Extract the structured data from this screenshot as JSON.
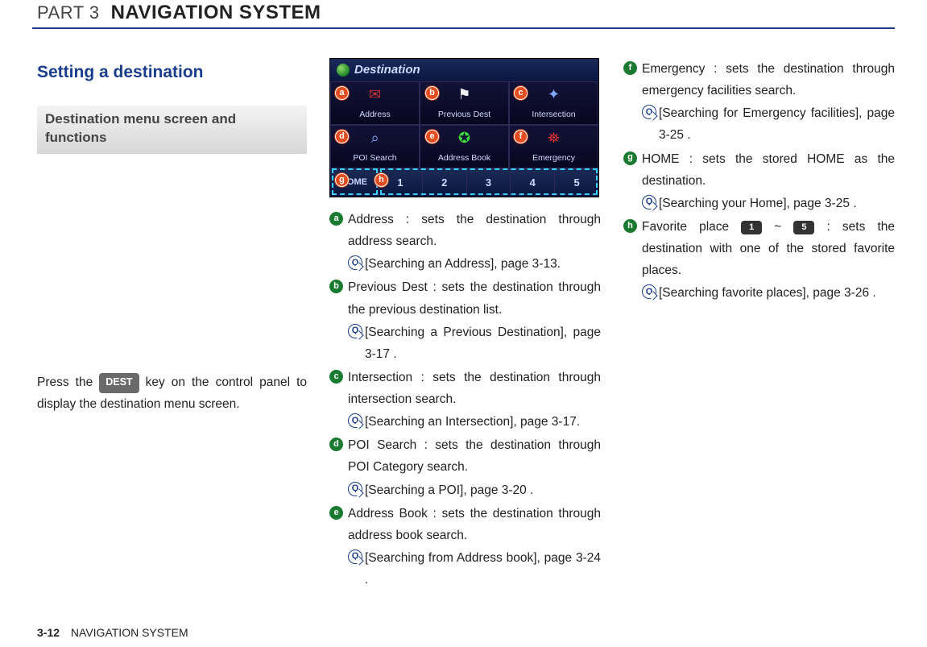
{
  "header": {
    "part_label": "PART 3",
    "part_title": "NAVIGATION SYSTEM"
  },
  "section": {
    "title": "Setting a destination",
    "subsection": "Destination menu screen and functions",
    "intro_pre": "Press the ",
    "intro_key": "DEST",
    "intro_post": " key on the control panel to display the destination menu screen."
  },
  "screen": {
    "title": "Destination",
    "cells": {
      "a": "Address",
      "b": "Previous Dest",
      "c": "Intersection",
      "d": "POI Search",
      "e": "Address Book",
      "f": "Emergency"
    },
    "home": "HOME",
    "favorites": [
      "1",
      "2",
      "3",
      "4",
      "5"
    ]
  },
  "items": {
    "a": {
      "text": "Address : sets the destination through address search.",
      "ref": "[Searching an Address], page 3-13."
    },
    "b": {
      "text": "Previous Dest : sets the destination through the previous destination list.",
      "ref": "[Searching a Previous Destination], page 3-17 ."
    },
    "c": {
      "text": "Intersection : sets the destination through intersection search.",
      "ref": "[Searching an Intersection], page 3-17."
    },
    "d": {
      "text": "POI Search : sets the destination through POI Category search.",
      "ref": "[Searching a POI], page 3-20 ."
    },
    "e": {
      "text": "Address Book : sets the destination through address book search.",
      "ref": "[Searching from Address book], page 3-24 ."
    },
    "f": {
      "text": "Emergency : sets the destination through emergency facilities search.",
      "ref": "[Searching for Emergency facilities], page 3-25 ."
    },
    "g": {
      "text": "HOME : sets the stored HOME as the destination.",
      "ref": "[Searching your Home], page 3-25 ."
    },
    "h": {
      "text_pre": "Favorite place ",
      "badge1": "1",
      "sep": " ~ ",
      "badge2": "5",
      "text_post": " : sets the destination with one of the stored favorite places.",
      "ref": "[Searching favorite places], page 3-26 ."
    }
  },
  "footer": {
    "page": "3-12",
    "label": "NAVIGATION SYSTEM"
  }
}
